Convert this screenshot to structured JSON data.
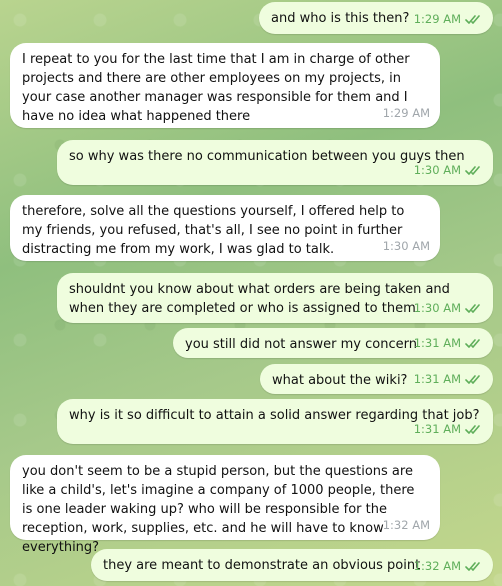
{
  "messages": [
    {
      "dir": "out",
      "text": "and who is this then?",
      "time": "1:29 AM"
    },
    {
      "dir": "in",
      "text": "I repeat to you for the last time that I am in charge of other projects and there are other employees on my projects, in your case another manager was responsible for them and I have no idea what happened there",
      "time": "1:29 AM"
    },
    {
      "dir": "out",
      "text": "so why was there no communication between you guys then",
      "time": "1:30 AM"
    },
    {
      "dir": "in",
      "text": "therefore, solve all the questions yourself, I offered help to my friends, you refused, that's all, I see no point in further distracting me from my work, I was glad to talk.",
      "time": "1:30 AM"
    },
    {
      "dir": "out",
      "text": "shouldnt you know about what orders are being taken and when they are completed or who is assigned to them",
      "time": "1:30 AM"
    },
    {
      "dir": "out",
      "text": "you still did not answer my concern",
      "time": "1:31 AM"
    },
    {
      "dir": "out",
      "text": "what about the wiki?",
      "time": "1:31 AM"
    },
    {
      "dir": "out",
      "text": "why is it so difficult to attain a solid answer regarding that job?",
      "time": "1:31 AM"
    },
    {
      "dir": "in",
      "text": "you don't seem to be a stupid person, but the questions are like a child's, let's imagine a company of 1000 people, there is one leader waking up? who will be responsible for the reception, work, supplies, etc. and he will have to know everything?",
      "time": "1:32 AM"
    },
    {
      "dir": "out",
      "text": "they are meant to demonstrate an obvious point",
      "time": "1:32 AM"
    }
  ],
  "colors": {
    "incoming_bubble": "#ffffff",
    "outgoing_bubble": "#effdde",
    "outgoing_meta": "#5fae5a",
    "incoming_meta": "#a0a6ab"
  }
}
